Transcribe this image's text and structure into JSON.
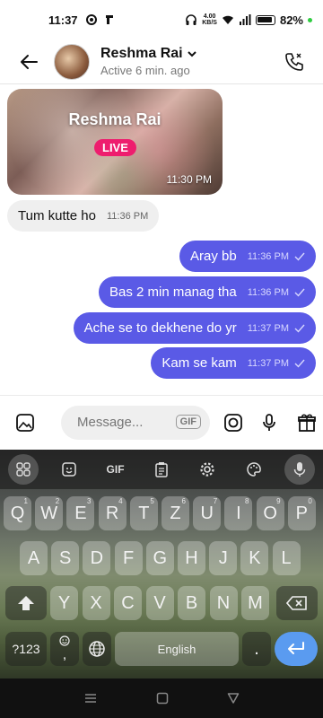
{
  "status_bar": {
    "time": "11:37",
    "battery": "82%",
    "net_speed_top": "4.00",
    "net_speed_bottom": "KB/S"
  },
  "header": {
    "name": "Reshma Rai",
    "status": "Active 6 min. ago"
  },
  "live_card": {
    "name": "Reshma Rai",
    "badge": "LIVE",
    "time": "11:30 PM"
  },
  "messages": [
    {
      "direction": "incoming",
      "text": "Tum kutte ho",
      "time": "11:36 PM"
    },
    {
      "direction": "outgoing",
      "text": "Aray bb",
      "time": "11:36 PM"
    },
    {
      "direction": "outgoing",
      "text": "Bas 2 min manag tha",
      "time": "11:36 PM"
    },
    {
      "direction": "outgoing",
      "text": "Ache se to dekhene do yr",
      "time": "11:37 PM"
    },
    {
      "direction": "outgoing",
      "text": "Kam se kam",
      "time": "11:37 PM"
    }
  ],
  "composer": {
    "placeholder": "Message...",
    "gif_label": "GIF"
  },
  "keyboard": {
    "toolbar_gif": "GIF",
    "row1": [
      {
        "k": "Q",
        "h": "1"
      },
      {
        "k": "W",
        "h": "2"
      },
      {
        "k": "E",
        "h": "3"
      },
      {
        "k": "R",
        "h": "4"
      },
      {
        "k": "T",
        "h": "5"
      },
      {
        "k": "Z",
        "h": "6"
      },
      {
        "k": "U",
        "h": "7"
      },
      {
        "k": "I",
        "h": "8"
      },
      {
        "k": "O",
        "h": "9"
      },
      {
        "k": "P",
        "h": "0"
      }
    ],
    "row2": [
      "A",
      "S",
      "D",
      "F",
      "G",
      "H",
      "J",
      "K",
      "L"
    ],
    "row3": [
      "Y",
      "X",
      "C",
      "V",
      "B",
      "N",
      "M"
    ],
    "symbols_label": "?123",
    "emoji_label": ",",
    "space_label": "English",
    "period_label": "."
  },
  "colors": {
    "outgoing_bubble": "#5a5ae6",
    "incoming_bubble": "#efefef",
    "live_badge": "#ee1d6e",
    "enter_key": "#5a9bf0"
  }
}
